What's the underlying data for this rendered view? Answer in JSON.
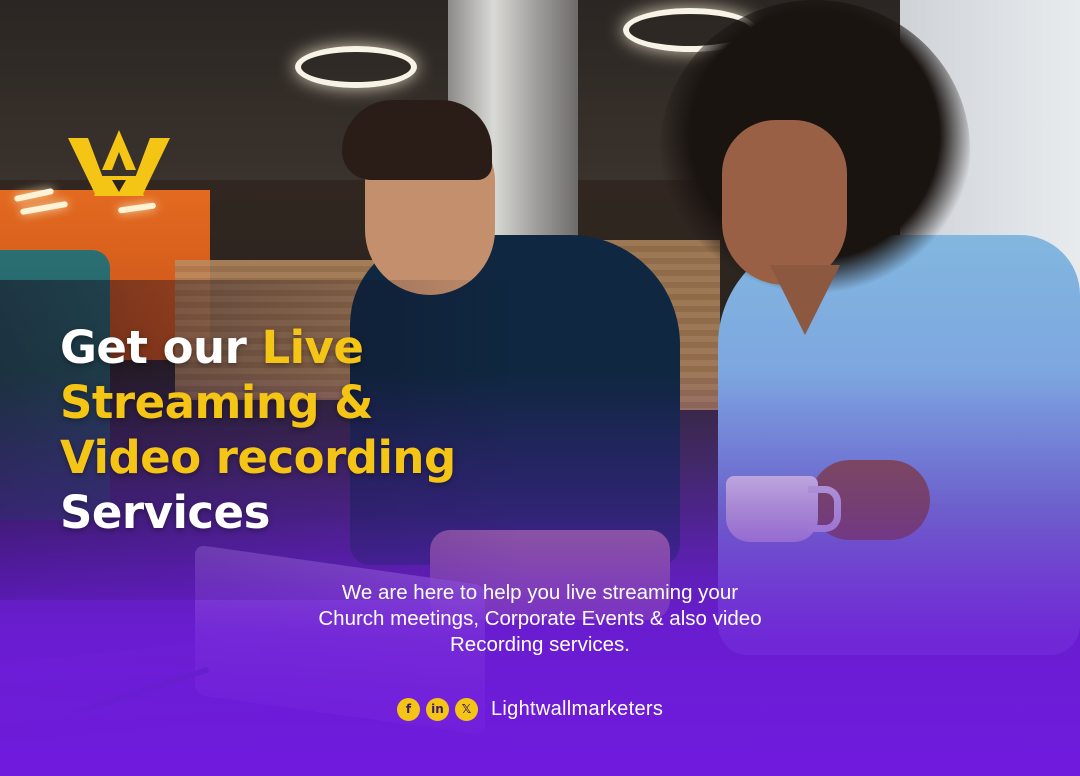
{
  "brand": {
    "logo_icon": "lightwall-logo-icon",
    "accent_color": "#F5C516",
    "overlay_color": "#6A1FD0"
  },
  "headline": {
    "line1_white": "Get our ",
    "line1_yellow": "Live",
    "line2_yellow": "Streaming &",
    "line3_yellow": "Video recording",
    "line4_white": "Services"
  },
  "description": {
    "line1": "We are here to help you live streaming your",
    "line2": "Church meetings, Corporate Events & also video",
    "line3": "Recording services."
  },
  "social": {
    "icons": [
      "facebook-icon",
      "linkedin-icon",
      "x-icon"
    ],
    "facebook_glyph": "f",
    "linkedin_glyph": "in",
    "x_glyph": "𝕏",
    "handle": "Lightwallmarketers"
  }
}
